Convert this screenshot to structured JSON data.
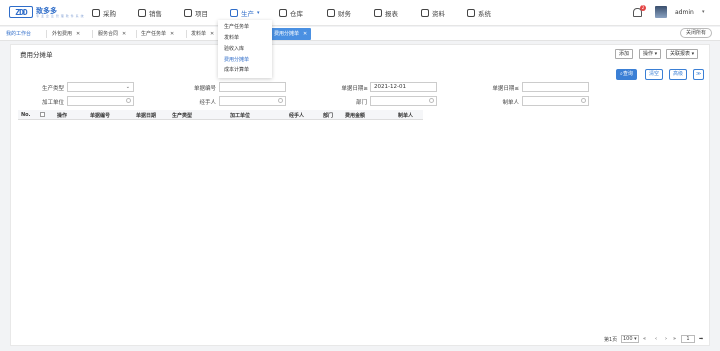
{
  "brand": {
    "logo": "ZDD",
    "name": "致多多",
    "tagline": "专 业 企 业 管 理 软 件 系 统"
  },
  "nav": [
    {
      "label": "采购",
      "icon": "cart-icon"
    },
    {
      "label": "销售",
      "icon": "chart-icon"
    },
    {
      "label": "项目",
      "icon": "project-icon"
    },
    {
      "label": "生产",
      "icon": "production-icon",
      "active": true
    },
    {
      "label": "仓库",
      "icon": "warehouse-icon"
    },
    {
      "label": "财务",
      "icon": "finance-icon"
    },
    {
      "label": "报表",
      "icon": "report-icon"
    },
    {
      "label": "资料",
      "icon": "folder-icon"
    },
    {
      "label": "系统",
      "icon": "system-icon"
    }
  ],
  "user": {
    "name": "admin",
    "notifications": "2"
  },
  "production_menu": [
    "生产任务单",
    "发料单",
    "验收入库",
    "费用分摊单",
    "成本计算单"
  ],
  "tabs": [
    "我的工作台",
    "外包费用",
    "服务合同",
    "生产任务单",
    "发料单",
    "费用分摊单"
  ],
  "close_all": "关闭所有",
  "page_title": "费用分摊单",
  "toolbar": {
    "add": "添加",
    "operate": "操作 ▾",
    "reports": "关联报表 ▾"
  },
  "search": {
    "query": "查询",
    "clear": "清空",
    "more": "高级",
    "expand": "≫"
  },
  "filters": {
    "type_label": "生产类型",
    "type_value": "",
    "doc_no_label": "单据编号",
    "doc_no_value": "",
    "date_from_label": "单据日期≥",
    "date_from_value": "2021-12-01",
    "date_to_label": "单据日期≤",
    "date_to_value": "",
    "unit_label": "加工单位",
    "unit_value": "",
    "handler_label": "经手人",
    "handler_value": "",
    "dept_label": "部门",
    "dept_value": "",
    "maker_label": "制单人",
    "maker_value": ""
  },
  "columns": [
    "No.",
    "操作",
    "单据编号",
    "单据日期",
    "生产类型",
    "加工单位",
    "经手人",
    "部门",
    "费用金额",
    "制单人"
  ],
  "pager": {
    "info": "第1页",
    "size": "100",
    "first": "«",
    "prev": "‹",
    "next": "›",
    "last": "»",
    "page": "1",
    "go": "➡"
  }
}
